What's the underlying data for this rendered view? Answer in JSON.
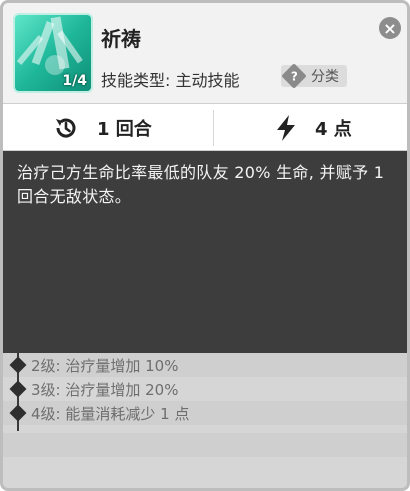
{
  "skill": {
    "name": "祈祷",
    "level_label": "1/4",
    "type_text": "技能类型: 主动技能",
    "category_icon": "?",
    "category_label": "分类",
    "close_symbol": "×"
  },
  "stats": {
    "turns_icon": "history-icon",
    "turns": "1 回合",
    "energy_icon": "lightning-icon",
    "energy": "4 点"
  },
  "description": "治疗己方生命比率最低的队友 20% 生命, 并赋予 1 回合无敌状态。",
  "upgrades": [
    {
      "label": "2级: 治疗量增加 10%"
    },
    {
      "label": "3级: 治疗量增加 20%"
    },
    {
      "label": "4级: 能量消耗减少 1 点"
    }
  ],
  "colors": {
    "icon_accent": "#1fb79a",
    "description_bg": "#3d3d3d",
    "upgrade_text": "#6e6e6e"
  }
}
